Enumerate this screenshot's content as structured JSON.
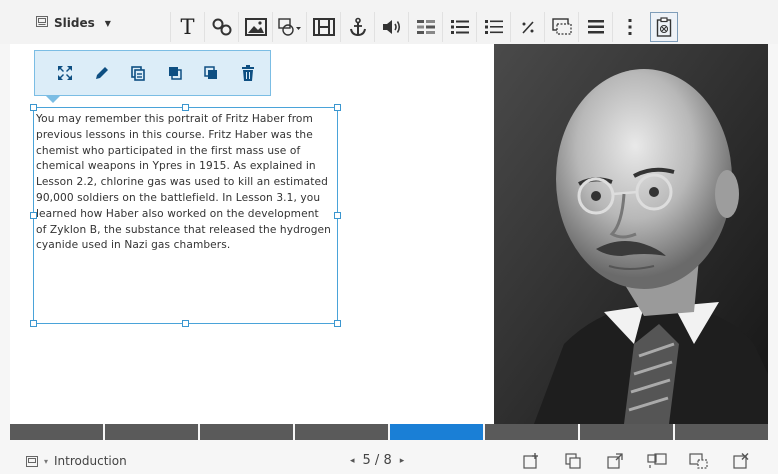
{
  "toolbar": {
    "slides_label": "Slides",
    "tools": [
      {
        "name": "text-icon",
        "glyph": "T"
      },
      {
        "name": "link-icon"
      },
      {
        "name": "image-icon"
      },
      {
        "name": "shape-icon"
      },
      {
        "name": "video-icon"
      },
      {
        "name": "anchor-icon"
      },
      {
        "name": "audio-icon"
      },
      {
        "name": "table-icon"
      },
      {
        "name": "bullet-list-icon"
      },
      {
        "name": "numbered-list-icon"
      },
      {
        "name": "math-icon"
      },
      {
        "name": "comment-icon"
      },
      {
        "name": "list-icon"
      },
      {
        "name": "more-icon"
      },
      {
        "name": "paste-icon"
      }
    ]
  },
  "editbar": {
    "buttons": [
      "move-icon",
      "edit-icon",
      "duplicate-icon",
      "bring-front-icon",
      "send-back-icon",
      "delete-icon"
    ]
  },
  "slide": {
    "text_lines": [
      "You may remember this portrait of Fritz Haber from",
      "previous lessons in this course. Fritz Haber was the",
      "chemist who participated in the first mass use of",
      "chemical weapons in Ypres in 1915. As explained in",
      "Lesson 2.2, chlorine gas was used to kill an estimated",
      "90,000 soldiers on the battlefield. In Lesson 3.1, you",
      "learned how Haber also worked on the development",
      "of Zyklon B, the substance that released the hydrogen",
      "cyanide used in Nazi gas chambers."
    ]
  },
  "progress": {
    "total": 8,
    "current": 5
  },
  "bottombar": {
    "section_label": "Introduction",
    "page_indicator": "5 / 8",
    "prev_arrow": "◂",
    "next_arrow": "▸",
    "icons": [
      "add-slide-icon",
      "duplicate-slide-icon",
      "import-slide-icon",
      "comment-slide-icon",
      "hide-slide-icon",
      "delete-slide-icon"
    ]
  },
  "colors": {
    "accent": "#1a7fd6",
    "selection": "#4aa3d9",
    "editbar_bg": "#dcedf8"
  }
}
